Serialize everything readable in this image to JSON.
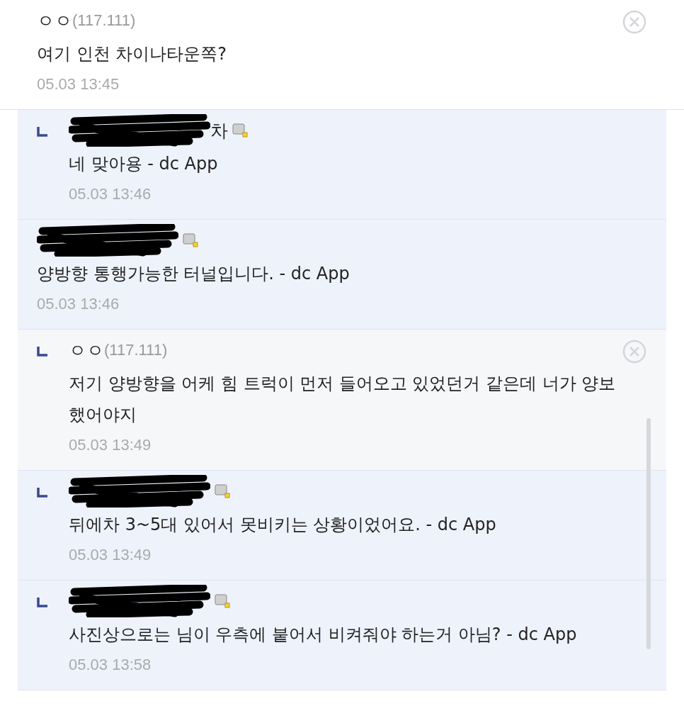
{
  "comments": [
    {
      "kind": "anon",
      "reply": false,
      "name": "ㅇㅇ",
      "ip": "(117.111)",
      "text": "여기 인천 차이나타운쪽?",
      "time": "05.03 13:45",
      "deletable": true
    },
    {
      "kind": "member",
      "reply": true,
      "name_visible": "차",
      "text": "네 맞아용 - dc App",
      "time": "05.03 13:46",
      "deletable": false
    },
    {
      "kind": "member",
      "reply": false,
      "text": "양방향 통행가능한 터널입니다. - dc App",
      "time": "05.03 13:46",
      "deletable": false
    },
    {
      "kind": "anon",
      "reply": true,
      "name": "ㅇㅇ",
      "ip": "(117.111)",
      "text": "저기 양방향을 어케 힘 트럭이 먼저 들어오고 있었던거 같은데 너가 양보했어야지",
      "time": "05.03 13:49",
      "deletable": true
    },
    {
      "kind": "member",
      "reply": true,
      "text": "뒤에차 3~5대 있어서 못비키는 상황이었어요. - dc App",
      "time": "05.03 13:49",
      "deletable": false
    },
    {
      "kind": "member",
      "reply": true,
      "text": "사진상으로는 님이 우측에 붙어서 비켜줘야 하는거 아님? - dc App",
      "time": "05.03 13:58",
      "deletable": false
    }
  ]
}
